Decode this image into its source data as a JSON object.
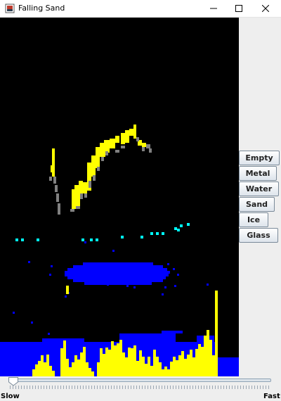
{
  "window": {
    "title": "Falling Sand",
    "app_icon": "falling-sand-app-icon",
    "controls": [
      "minimize-icon",
      "maximize-icon",
      "close-icon"
    ]
  },
  "tools": [
    {
      "label": "Empty",
      "color": "#000000"
    },
    {
      "label": "Metal",
      "color": "#808080"
    },
    {
      "label": "Water",
      "color": "#0000ff"
    },
    {
      "label": "Sand",
      "color": "#ffff00"
    },
    {
      "label": "Ice",
      "color": "#00ffff"
    },
    {
      "label": "Glass",
      "color": "#ffffff"
    }
  ],
  "speed_slider": {
    "min_label": "Slow",
    "max_label": "Fast",
    "value_fraction": 0.0
  },
  "colors": {
    "empty": "#000000",
    "metal": "#808080",
    "water": "#0000ff",
    "sand": "#ffff00",
    "ice": "#00ffff"
  }
}
